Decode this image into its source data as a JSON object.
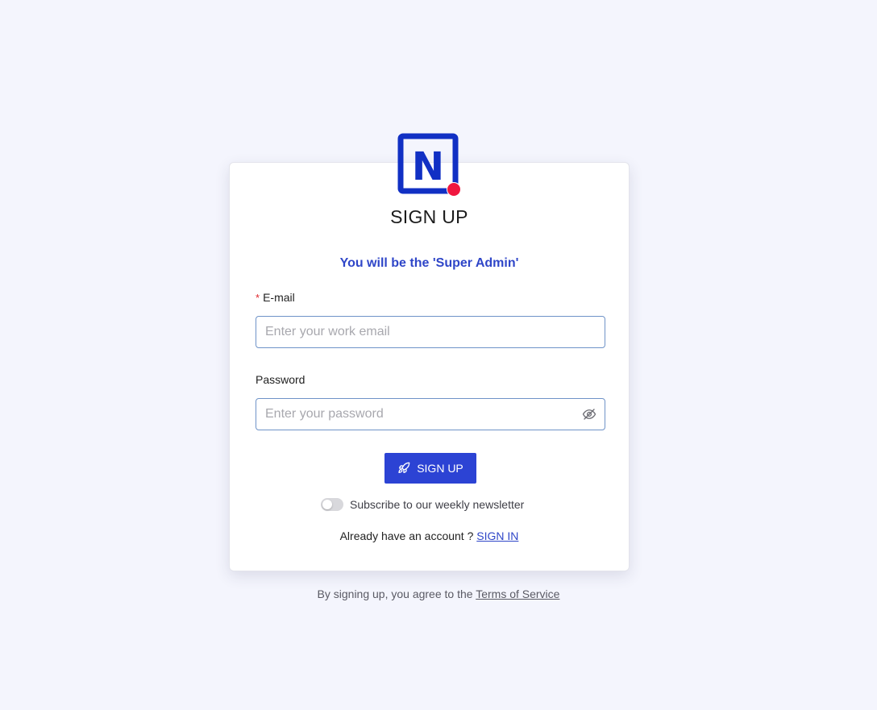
{
  "logo": {
    "icon": "n-logo-icon",
    "letter": "N",
    "brand_color": "#1130c4",
    "dot_color": "#f0173f"
  },
  "card": {
    "title": "SIGN UP",
    "subtitle": "You will be the 'Super Admin'"
  },
  "email": {
    "required_mark": "*",
    "label": "E-mail",
    "placeholder": "Enter your work email",
    "value": ""
  },
  "password": {
    "label": "Password",
    "placeholder": "Enter your password",
    "value": "",
    "toggle_icon": "eye-slash-icon"
  },
  "signup_button": {
    "icon": "rocket-icon",
    "label": "SIGN UP",
    "color": "#2c43d4"
  },
  "newsletter": {
    "label": "Subscribe to our weekly newsletter",
    "enabled": false
  },
  "signin": {
    "prompt": "Already have an account ?",
    "link_label": "SIGN IN"
  },
  "terms": {
    "prefix": "By signing up, you agree to the",
    "link_label": "Terms of Service"
  },
  "colors": {
    "background": "#f4f5fd",
    "accent": "#2f46c8",
    "input_border": "#6f93c8"
  }
}
